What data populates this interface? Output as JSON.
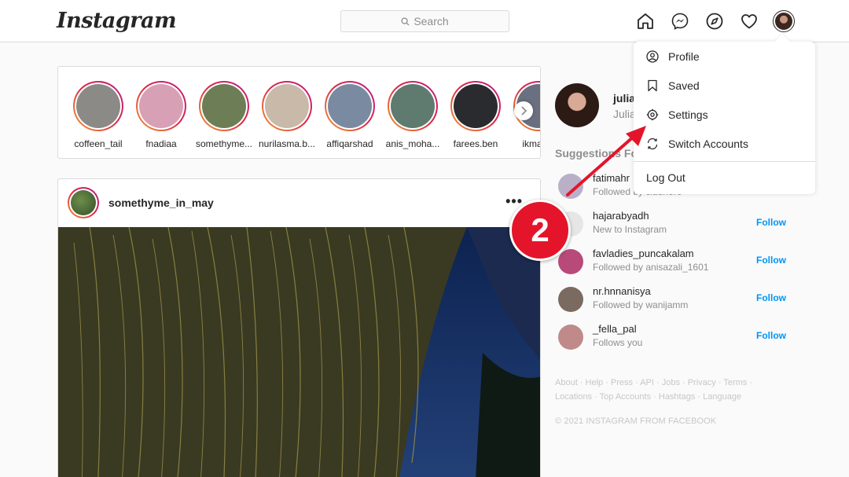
{
  "app": {
    "logo": "Instagram"
  },
  "search": {
    "placeholder": "Search"
  },
  "nav": {
    "icons": [
      "home-icon",
      "messenger-icon",
      "explore-icon",
      "heart-icon",
      "avatar"
    ]
  },
  "stories": [
    {
      "username": "coffeen_tail",
      "color": "#8b8a86"
    },
    {
      "username": "fnadiaa",
      "color": "#d8a0b5"
    },
    {
      "username": "somethyme...",
      "color": "#6d7d55"
    },
    {
      "username": "nurilasma.b...",
      "color": "#c9b9a8"
    },
    {
      "username": "affiqarshad",
      "color": "#7a8aa0"
    },
    {
      "username": "anis_moha...",
      "color": "#5f7a6e"
    },
    {
      "username": "farees.ben",
      "color": "#2a2b2f"
    },
    {
      "username": "ikmal_h",
      "color": "#6a7080"
    }
  ],
  "post": {
    "username": "somethyme_in_may",
    "more": "•••"
  },
  "profile": {
    "username": "julia",
    "name": "Julia"
  },
  "suggestions": {
    "title": "Suggestions For",
    "items": [
      {
        "username": "fatimahr",
        "subtitle": "Followed by cluuhere",
        "follow": "",
        "color": "#b9b0c8"
      },
      {
        "username": "hajarabyadh",
        "subtitle": "New to Instagram",
        "follow": "Follow",
        "color": "#e6e6e6"
      },
      {
        "username": "favladies_puncakalam",
        "subtitle": "Followed by anisazali_1601",
        "follow": "Follow",
        "color": "#b84a7a"
      },
      {
        "username": "nr.hnnanisya",
        "subtitle": "Followed by wanijamm",
        "follow": "Follow",
        "color": "#7a6a60"
      },
      {
        "username": "_fella_pal",
        "subtitle": "Follows you",
        "follow": "Follow",
        "color": "#c08a8a"
      }
    ]
  },
  "footer": {
    "links": "About · Help · Press · API · Jobs · Privacy · Terms · Locations · Top Accounts · Hashtags · Language",
    "copyright": "© 2021 INSTAGRAM FROM FACEBOOK"
  },
  "dropdown": {
    "profile": "Profile",
    "saved": "Saved",
    "settings": "Settings",
    "switch_accounts": "Switch Accounts",
    "logout": "Log Out"
  },
  "annotation": {
    "step_number": "2",
    "color": "#e4152a"
  }
}
